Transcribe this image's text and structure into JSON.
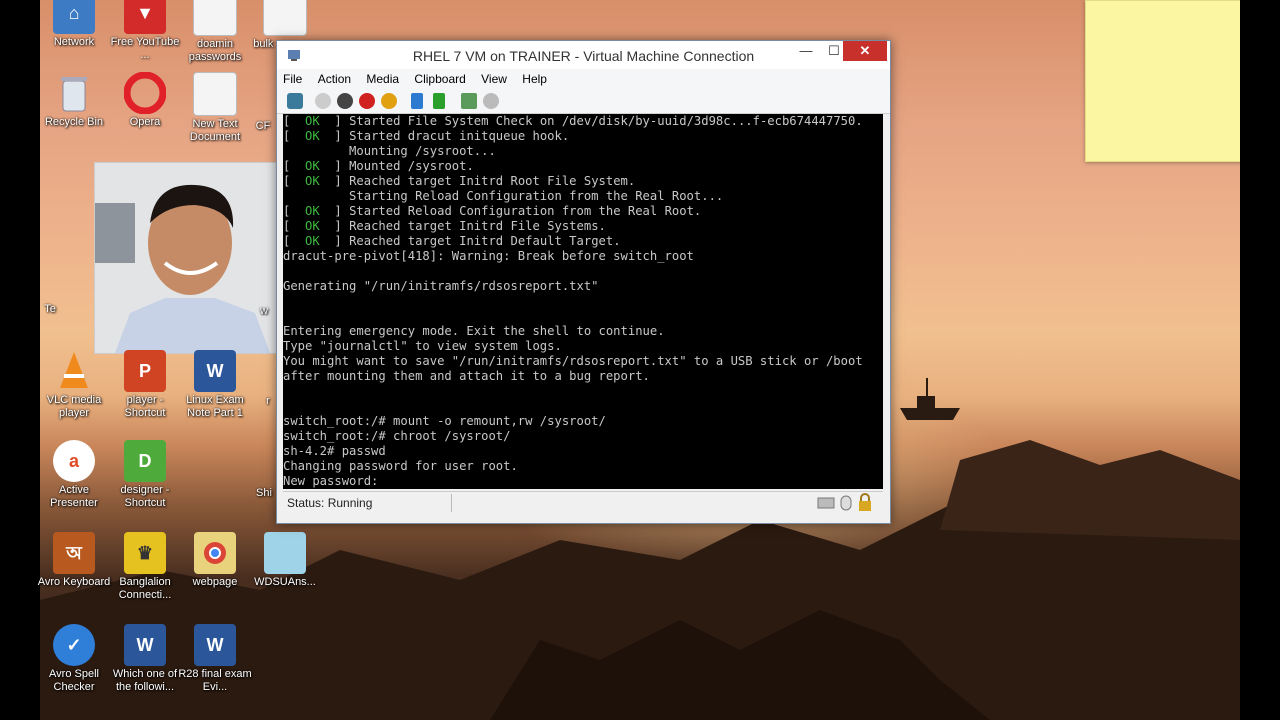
{
  "desktop": {
    "icons": [
      {
        "label": "Network"
      },
      {
        "label": "Free YouTube ..."
      },
      {
        "label": "doamin passwords"
      },
      {
        "label": "bulk user.csv"
      },
      {
        "label": "Recycle Bin"
      },
      {
        "label": "Opera"
      },
      {
        "label": "New Text Document"
      },
      {
        "label": "VLC media player"
      },
      {
        "label": "player - Shortcut"
      },
      {
        "label": "Linux Exam Note Part 1"
      },
      {
        "label": "Active Presenter"
      },
      {
        "label": "designer - Shortcut"
      },
      {
        "label": "Avro Keyboard"
      },
      {
        "label": "Banglalion Connecti..."
      },
      {
        "label": "webpage"
      },
      {
        "label": "WDSUAns..."
      },
      {
        "label": "Avro Spell Checker"
      },
      {
        "label": "Which one of the followi..."
      },
      {
        "label": "R28 final exam Evi..."
      }
    ],
    "partial_labels": [
      "CF",
      "Te",
      "w",
      "r",
      "Shi"
    ]
  },
  "window": {
    "title": "RHEL 7 VM on TRAINER - Virtual Machine Connection",
    "menu": [
      "File",
      "Action",
      "Media",
      "Clipboard",
      "View",
      "Help"
    ],
    "status": "Status: Running",
    "colors": {
      "close": "#c7302b",
      "ok": "#3fb83f",
      "terminal_bg": "#000000"
    }
  },
  "terminal": {
    "lines": [
      {
        "ok": "  OK  ",
        "text": "Started File System Check on /dev/disk/by-uuid/3d98c...f-ecb674447750."
      },
      {
        "ok": "  OK  ",
        "text": "Started dracut initqueue hook."
      },
      {
        "ok": "",
        "text": "         Mounting /sysroot..."
      },
      {
        "ok": "  OK  ",
        "text": "Mounted /sysroot."
      },
      {
        "ok": "  OK  ",
        "text": "Reached target Initrd Root File System."
      },
      {
        "ok": "",
        "text": "         Starting Reload Configuration from the Real Root..."
      },
      {
        "ok": "  OK  ",
        "text": "Started Reload Configuration from the Real Root."
      },
      {
        "ok": "  OK  ",
        "text": "Reached target Initrd File Systems."
      },
      {
        "ok": "  OK  ",
        "text": "Reached target Initrd Default Target."
      },
      {
        "ok": "",
        "text": "dracut-pre-pivot[418]: Warning: Break before switch_root"
      },
      {
        "ok": "",
        "text": ""
      },
      {
        "ok": "",
        "text": "Generating \"/run/initramfs/rdsosreport.txt\""
      },
      {
        "ok": "",
        "text": ""
      },
      {
        "ok": "",
        "text": ""
      },
      {
        "ok": "",
        "text": "Entering emergency mode. Exit the shell to continue."
      },
      {
        "ok": "",
        "text": "Type \"journalctl\" to view system logs."
      },
      {
        "ok": "",
        "text": "You might want to save \"/run/initramfs/rdsosreport.txt\" to a USB stick or /boot"
      },
      {
        "ok": "",
        "text": "after mounting them and attach it to a bug report."
      },
      {
        "ok": "",
        "text": ""
      },
      {
        "ok": "",
        "text": ""
      },
      {
        "ok": "",
        "text": "switch_root:/# mount -o remount,rw /sysroot/"
      },
      {
        "ok": "",
        "text": "switch_root:/# chroot /sysroot/"
      },
      {
        "ok": "",
        "text": "sh-4.2# passwd"
      },
      {
        "ok": "",
        "text": "Changing password for user root."
      },
      {
        "ok": "",
        "text": "New password: "
      }
    ]
  }
}
